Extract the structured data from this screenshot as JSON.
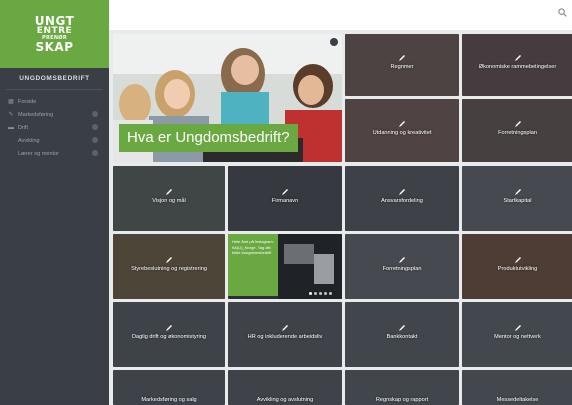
{
  "brand": {
    "logo_line1": "UNGT",
    "logo_line2": "ENTRE",
    "logo_line3": "PRENØR",
    "logo_line4": "SKAP",
    "company_name": "UNGDOMSBEDRIFT",
    "color_green": "#6aa842",
    "color_sidebar": "#3a3f45"
  },
  "sidebar": {
    "items": [
      {
        "label": "Forside",
        "icon": "grid-icon"
      },
      {
        "label": "Markedsføring",
        "icon": "pencil-icon"
      },
      {
        "label": "Drift",
        "icon": "folder-icon"
      },
      {
        "label": "Avvikling",
        "icon": ""
      },
      {
        "label": "Lærer og mentor",
        "icon": ""
      }
    ]
  },
  "hero": {
    "caption": "Hva er Ungdomsbedrift?"
  },
  "tiles": [
    {
      "label": "Regnmer"
    },
    {
      "label": "Økonomiske rammebetingelser"
    },
    {
      "label": "Utdanning og kreativitet"
    },
    {
      "label": "Forretningsplan"
    },
    {
      "label": "Visjon og mål"
    },
    {
      "label": "Firmanavn"
    },
    {
      "label": "Ansvarsfordeling"
    },
    {
      "label": "Startkapital"
    },
    {
      "label": "Styrebeslutning og registrering"
    },
    {
      "label": "Forretningsplan"
    },
    {
      "label": "Produktutvikling"
    },
    {
      "label": "Daglig drift og økonomistyring"
    },
    {
      "label": "HR og inkluderende arbeidsliv"
    },
    {
      "label": "Bankkontakt"
    },
    {
      "label": "Mentor og nettverk"
    },
    {
      "label": "Markedsføring og salg"
    },
    {
      "label": "Avvikling og avslutning"
    },
    {
      "label": "Regnskap og rapport"
    },
    {
      "label": "Messedeltakelse"
    }
  ],
  "ad": {
    "text": "Hele året på Instagram: 9A(U)_Norge. Tag ditt bilde #ungdomsbedrift"
  },
  "search": {
    "icon": "search-icon"
  }
}
